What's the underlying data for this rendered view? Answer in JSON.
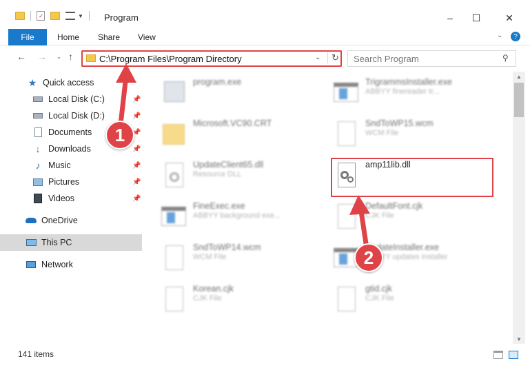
{
  "window": {
    "title": "Program",
    "controls": {
      "minimize": "–",
      "maximize": "☐",
      "close": "✕"
    }
  },
  "ribbon": {
    "file_label": "File",
    "tabs": [
      "Home",
      "Share",
      "View"
    ]
  },
  "address_bar": {
    "path": "C:\\Program Files\\Program Directory"
  },
  "search": {
    "placeholder": "Search Program"
  },
  "sidebar": {
    "items": [
      {
        "label": "Quick access",
        "icon": "star-icon",
        "pinned": false
      },
      {
        "label": "Local Disk (C:)",
        "icon": "drive-icon",
        "pinned": true
      },
      {
        "label": "Local Disk (D:)",
        "icon": "drive-icon",
        "pinned": true
      },
      {
        "label": "Documents",
        "icon": "documents-icon",
        "pinned": true
      },
      {
        "label": "Downloads",
        "icon": "downloads-icon",
        "pinned": true
      },
      {
        "label": "Music",
        "icon": "music-icon",
        "pinned": true
      },
      {
        "label": "Pictures",
        "icon": "pictures-icon",
        "pinned": true
      },
      {
        "label": "Videos",
        "icon": "videos-icon",
        "pinned": true
      },
      {
        "label": "OneDrive",
        "icon": "onedrive-icon",
        "pinned": false
      },
      {
        "label": "This PC",
        "icon": "this-pc-icon",
        "pinned": false,
        "selected": true
      },
      {
        "label": "Network",
        "icon": "network-icon",
        "pinned": false
      }
    ]
  },
  "files": [
    {
      "name": "program.exe",
      "desc": "",
      "icon": "exe-icon",
      "blurred": true
    },
    {
      "name": "TrigrammsInstaller.exe",
      "desc": "ABBYY finereader tr...",
      "icon": "installer-icon",
      "blurred": true
    },
    {
      "name": "Microsoft.VC90.CRT",
      "desc": "",
      "icon": "folder-icon",
      "blurred": true
    },
    {
      "name": "SndToWP15.wcm",
      "desc": "WCM File",
      "icon": "file-icon",
      "blurred": true
    },
    {
      "name": "UpdateClient65.dll",
      "desc": "Resource DLL",
      "icon": "dll-icon",
      "blurred": true
    },
    {
      "name": "amp11lib.dll",
      "desc": "",
      "icon": "dll-icon",
      "blurred": false
    },
    {
      "name": "FineExec.exe",
      "desc": "ABBYY background exe...",
      "icon": "installer-icon",
      "blurred": true
    },
    {
      "name": "DefaultFont.cjk",
      "desc": "CJK File",
      "icon": "file-icon",
      "blurred": true
    },
    {
      "name": "SndToWP14.wcm",
      "desc": "WCM File",
      "icon": "file-icon",
      "blurred": true
    },
    {
      "name": "UpdateInstaller.exe",
      "desc": "ABBYY updates installer",
      "icon": "installer-icon",
      "blurred": true
    },
    {
      "name": "Korean.cjk",
      "desc": "CJK File",
      "icon": "file-icon",
      "blurred": true
    },
    {
      "name": "gtid.cjk",
      "desc": "CJK File",
      "icon": "file-icon",
      "blurred": true
    }
  ],
  "markers": [
    "1",
    "2"
  ],
  "status": {
    "item_count": "141 items"
  },
  "colors": {
    "accent": "#1979ca",
    "highlight": "#e04347",
    "selection": "#d9d9d9"
  }
}
